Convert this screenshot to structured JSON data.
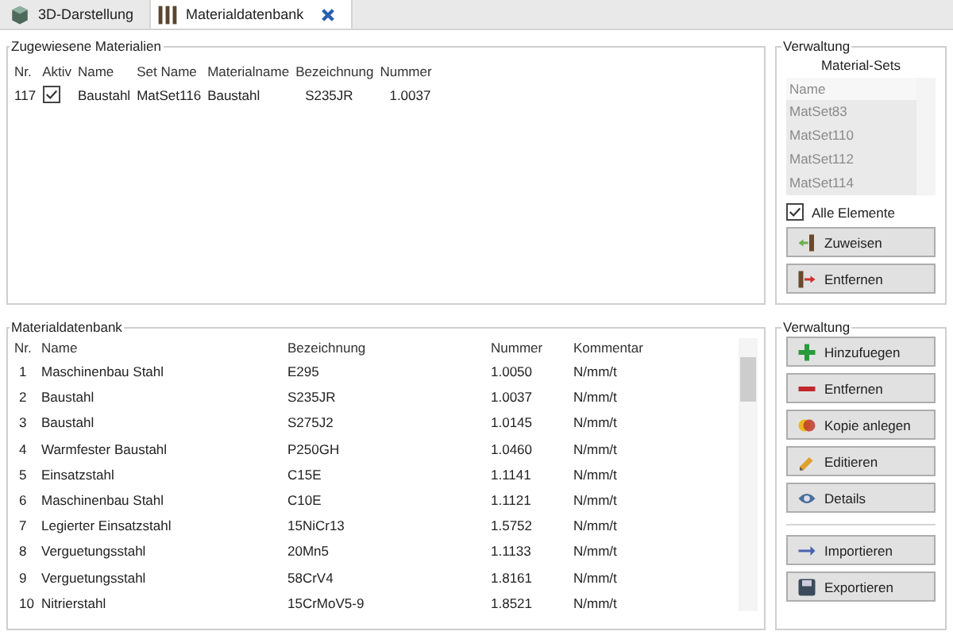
{
  "tabs": [
    {
      "label": "3D-Darstellung",
      "selected": false
    },
    {
      "label": "Materialdatenbank",
      "selected": true
    }
  ],
  "assigned": {
    "title": "Zugewiesene Materialien",
    "columns": [
      "Nr.",
      "Aktiv",
      "Name",
      "Set Name",
      "Materialname",
      "Bezeichnung",
      "Nummer"
    ],
    "rows": [
      {
        "nr": "117",
        "active": true,
        "name": "Baustahl",
        "set_name": "MatSet116",
        "material_name": "Baustahl",
        "designation": "S235JR",
        "number": "1.0037"
      }
    ]
  },
  "sets_panel": {
    "title": "Verwaltung",
    "list_title": "Material-Sets",
    "list_header": "Name",
    "items": [
      "MatSet83",
      "MatSet110",
      "MatSet112",
      "MatSet114"
    ],
    "all_elements": {
      "label": "Alle Elemente",
      "checked": true
    },
    "buttons": [
      "Zuweisen",
      "Entfernen"
    ]
  },
  "database": {
    "title": "Materialdatenbank",
    "columns": [
      "Nr.",
      "Name",
      "Bezeichnung",
      "Nummer",
      "Kommentar"
    ],
    "rows": [
      {
        "nr": "1",
        "name": "Maschinenbau Stahl",
        "designation": "E295",
        "number": "1.0050",
        "comment": "N/mm/t"
      },
      {
        "nr": "2",
        "name": "Baustahl",
        "designation": "S235JR",
        "number": "1.0037",
        "comment": "N/mm/t"
      },
      {
        "nr": "3",
        "name": "Baustahl",
        "designation": "S275J2",
        "number": "1.0145",
        "comment": "N/mm/t"
      },
      {
        "nr": "4",
        "name": "Warmfester Baustahl",
        "designation": "P250GH",
        "number": "1.0460",
        "comment": "N/mm/t"
      },
      {
        "nr": "5",
        "name": "Einsatzstahl",
        "designation": "C15E",
        "number": "1.1141",
        "comment": "N/mm/t"
      },
      {
        "nr": "6",
        "name": "Maschinenbau Stahl",
        "designation": "C10E",
        "number": "1.1121",
        "comment": "N/mm/t"
      },
      {
        "nr": "7",
        "name": "Legierter Einsatzstahl",
        "designation": "15NiCr13",
        "number": "1.5752",
        "comment": "N/mm/t"
      },
      {
        "nr": "8",
        "name": "Verguetungsstahl",
        "designation": "20Mn5",
        "number": "1.1133",
        "comment": "N/mm/t"
      },
      {
        "nr": "9",
        "name": "Verguetungsstahl",
        "designation": "58CrV4",
        "number": "1.8161",
        "comment": "N/mm/t"
      },
      {
        "nr": "10",
        "name": "Nitrierstahl",
        "designation": "15CrMoV5-9",
        "number": "1.8521",
        "comment": "N/mm/t"
      }
    ]
  },
  "db_panel": {
    "title": "Verwaltung",
    "button_groups": [
      [
        "Hinzufuegen",
        "Entfernen",
        "Kopie anlegen",
        "Editieren",
        "Details"
      ],
      [
        "Importieren",
        "Exportieren"
      ]
    ]
  }
}
